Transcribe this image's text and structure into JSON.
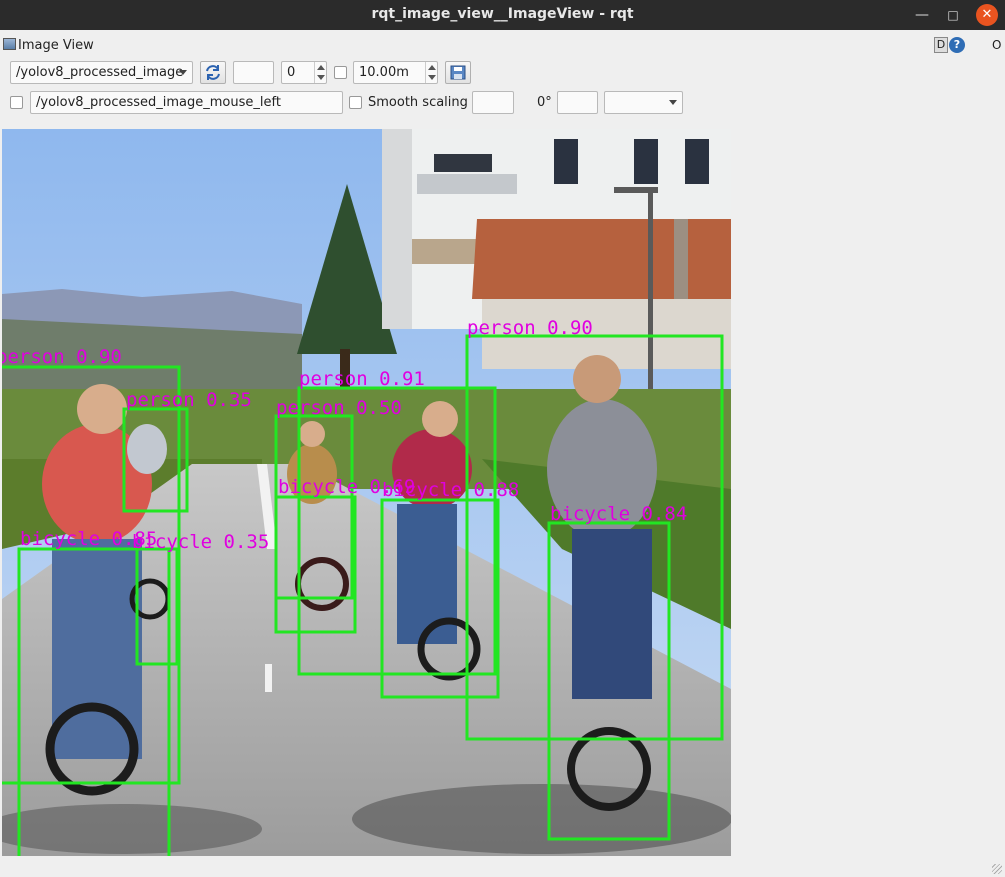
{
  "window": {
    "title": "rqt_image_view__ImageView - rqt"
  },
  "plugin": {
    "title": "Image View",
    "d_label": "D",
    "help_label": "?",
    "o_label": "O"
  },
  "toolbar": {
    "topic": "/yolov8_processed_image",
    "spin_value": "0",
    "distance_value": "10.00m",
    "mouse_topic": "/yolov8_processed_image_mouse_left",
    "smooth_scaling_label": "Smooth scaling",
    "rotation_label": "0°"
  },
  "detections": [
    {
      "label": "person 0.90"
    },
    {
      "label": "person 0.35"
    },
    {
      "label": "person 0.91"
    },
    {
      "label": "person 0.50"
    },
    {
      "label": "person 0.90"
    },
    {
      "label": "bicycle 0.69"
    },
    {
      "label": "bicycle 0.88"
    },
    {
      "label": "bicycle 0.85"
    },
    {
      "label": "bicycle 0.35"
    },
    {
      "label": "bicycle 0.84"
    }
  ],
  "colors": {
    "box": "#22e622",
    "label": "#e000e0",
    "close": "#e95420"
  }
}
